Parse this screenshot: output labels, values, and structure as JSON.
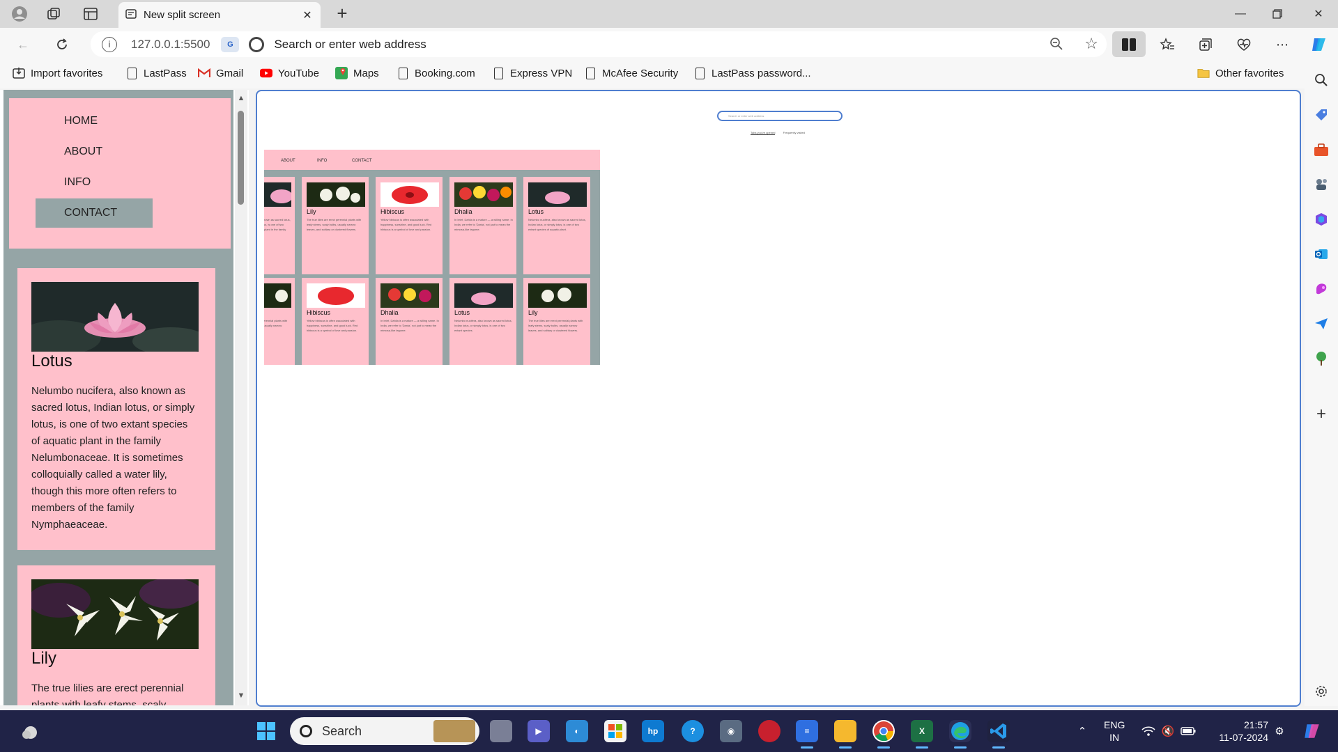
{
  "browser": {
    "tab_title": "New split screen",
    "url_host": "127.0.0.1:5500",
    "omnibox_placeholder": "Search or enter web address"
  },
  "favorites": {
    "items": [
      {
        "label": "Import favorites",
        "icon": "import-icon"
      },
      {
        "label": "LastPass",
        "icon": "page-icon"
      },
      {
        "label": "Gmail",
        "icon": "gmail-icon"
      },
      {
        "label": "YouTube",
        "icon": "youtube-icon"
      },
      {
        "label": "Maps",
        "icon": "maps-icon"
      },
      {
        "label": "Booking.com",
        "icon": "page-icon"
      },
      {
        "label": "Express VPN",
        "icon": "page-icon"
      },
      {
        "label": "McAfee Security",
        "icon": "page-icon"
      },
      {
        "label": "LastPass password...",
        "icon": "page-icon"
      }
    ],
    "other": "Other favorites"
  },
  "site": {
    "menu": [
      "HOME",
      "ABOUT",
      "INFO",
      "CONTACT"
    ],
    "active_menu": "CONTACT",
    "cards": [
      {
        "name": "Lotus",
        "text": "Nelumbo nucifera, also known as sacred lotus, Indian lotus, or simply lotus, is one of two extant species of aquatic plant in the family Nelumbonaceae. It is sometimes colloquially called a water lily, though this more often refers to members of the family Nymphaeaceae."
      },
      {
        "name": "Lily",
        "text": "The true lilies are erect perennial plants with leafy stems, scaly"
      }
    ]
  },
  "split_view": {
    "search_placeholder": "Search or enter web address",
    "tab_a": "Tabs you've opened",
    "tab_b": "Frequently visited",
    "preview_menu": [
      "ABOUT",
      "INFO",
      "CONTACT"
    ],
    "preview_row1": [
      "",
      "Lily",
      "Hibiscus",
      "Dhalia",
      "Lotus"
    ],
    "preview_row2": [
      "",
      "Hibiscus",
      "Dhalia",
      "Lotus",
      "Lily"
    ]
  },
  "taskbar": {
    "search_label": "Search",
    "lang_top": "ENG",
    "lang_bottom": "IN",
    "time": "21:57",
    "date": "11-07-2024"
  },
  "colors": {
    "card_pink": "#ffc0cb",
    "frame_gray": "#95a5a6",
    "accent_blue": "#4f7ecf",
    "taskbar": "#202347"
  }
}
